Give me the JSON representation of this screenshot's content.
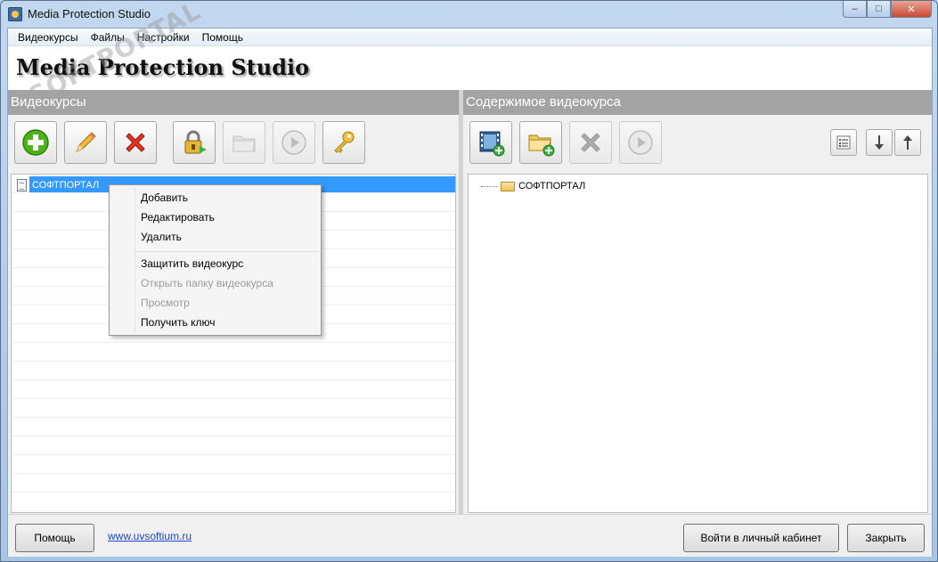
{
  "window": {
    "title": "Media Protection Studio"
  },
  "menu": [
    "Видеокурсы",
    "Файлы",
    "Настройки",
    "Помощь"
  ],
  "brand": {
    "title": "Media Protection Studio",
    "watermark": "SOFTPORTAL"
  },
  "left_panel": {
    "header": "Видеокурсы",
    "toolbar": [
      {
        "name": "add",
        "icon": "add-icon",
        "enabled": true
      },
      {
        "name": "edit",
        "icon": "pencil-icon",
        "enabled": true
      },
      {
        "name": "delete",
        "icon": "delete-icon",
        "enabled": true
      },
      {
        "name": "protect",
        "icon": "lock-icon",
        "enabled": true
      },
      {
        "name": "open-folder",
        "icon": "folder-icon",
        "enabled": false
      },
      {
        "name": "preview",
        "icon": "play-icon",
        "enabled": false
      },
      {
        "name": "get-key",
        "icon": "key-icon",
        "enabled": true
      }
    ],
    "tree_items": [
      "СОФТПОРТАЛ"
    ]
  },
  "right_panel": {
    "header": "Содержимое видеокурса",
    "toolbar": [
      {
        "name": "add-video",
        "icon": "video-add-icon",
        "enabled": true
      },
      {
        "name": "add-folder",
        "icon": "folder-add-icon",
        "enabled": true
      },
      {
        "name": "delete",
        "icon": "delete-icon",
        "enabled": false
      },
      {
        "name": "preview",
        "icon": "play-icon",
        "enabled": false
      }
    ],
    "tree_items": [
      "СОФТПОРТАЛ"
    ]
  },
  "context_menu": {
    "items": [
      {
        "label": "Добавить",
        "enabled": true
      },
      {
        "label": "Редактировать",
        "enabled": true
      },
      {
        "label": "Удалить",
        "enabled": true
      },
      {
        "label": "Защитить видеокурс",
        "enabled": true
      },
      {
        "label": "Открыть папку видеокурса",
        "enabled": false
      },
      {
        "label": "Просмотр",
        "enabled": false
      },
      {
        "label": "Получить ключ",
        "enabled": true
      }
    ]
  },
  "bottom": {
    "help_label": "Помощь",
    "website": "www.uvsoftium.ru",
    "account_label": "Войти в личный кабинет",
    "close_label": "Закрыть"
  },
  "colors": {
    "selection": "#3399ff",
    "panel_header": "#a3a3a3",
    "link": "#1b47d1"
  }
}
